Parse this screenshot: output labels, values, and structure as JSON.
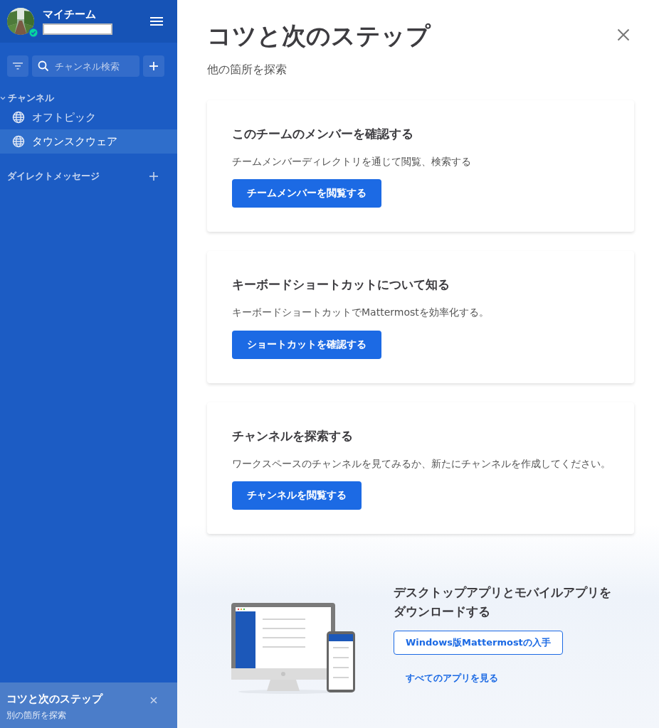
{
  "sidebar": {
    "team_name": "マイチーム",
    "search": {
      "placeholder": "チャンネル検索"
    },
    "channels": {
      "label": "チャンネル",
      "expanded": true,
      "items": [
        {
          "label": "オフトピック",
          "selected": false
        },
        {
          "label": "タウンスクウェア",
          "selected": true
        }
      ]
    },
    "direct_messages": {
      "label": "ダイレクトメッセージ"
    },
    "tips_panel": {
      "title": "コツと次のステップ",
      "subtitle": "別の箇所を探索"
    }
  },
  "main": {
    "title": "コツと次のステップ",
    "subtitle": "他の箇所を探索",
    "cards": [
      {
        "title": "このチームのメンバーを確認する",
        "description": "チームメンバーディレクトリを通じて閲覧、検索する",
        "button": "チームメンバーを閲覧する"
      },
      {
        "title": "キーボードショートカットについて知る",
        "description": "キーボードショートカットでMattermostを効率化する。",
        "button": "ショートカットを確認する"
      },
      {
        "title": "チャンネルを探索する",
        "description": "ワークスペースのチャンネルを見てみるか、新たにチャンネルを作成してください。",
        "button": "チャンネルを閲覧する"
      }
    ],
    "download": {
      "heading": "デスクトップアプリとモバイルアプリをダウンロードする",
      "primary_button": "Windows版Mattermostの入手",
      "link": "すべてのアプリを見る"
    }
  }
}
